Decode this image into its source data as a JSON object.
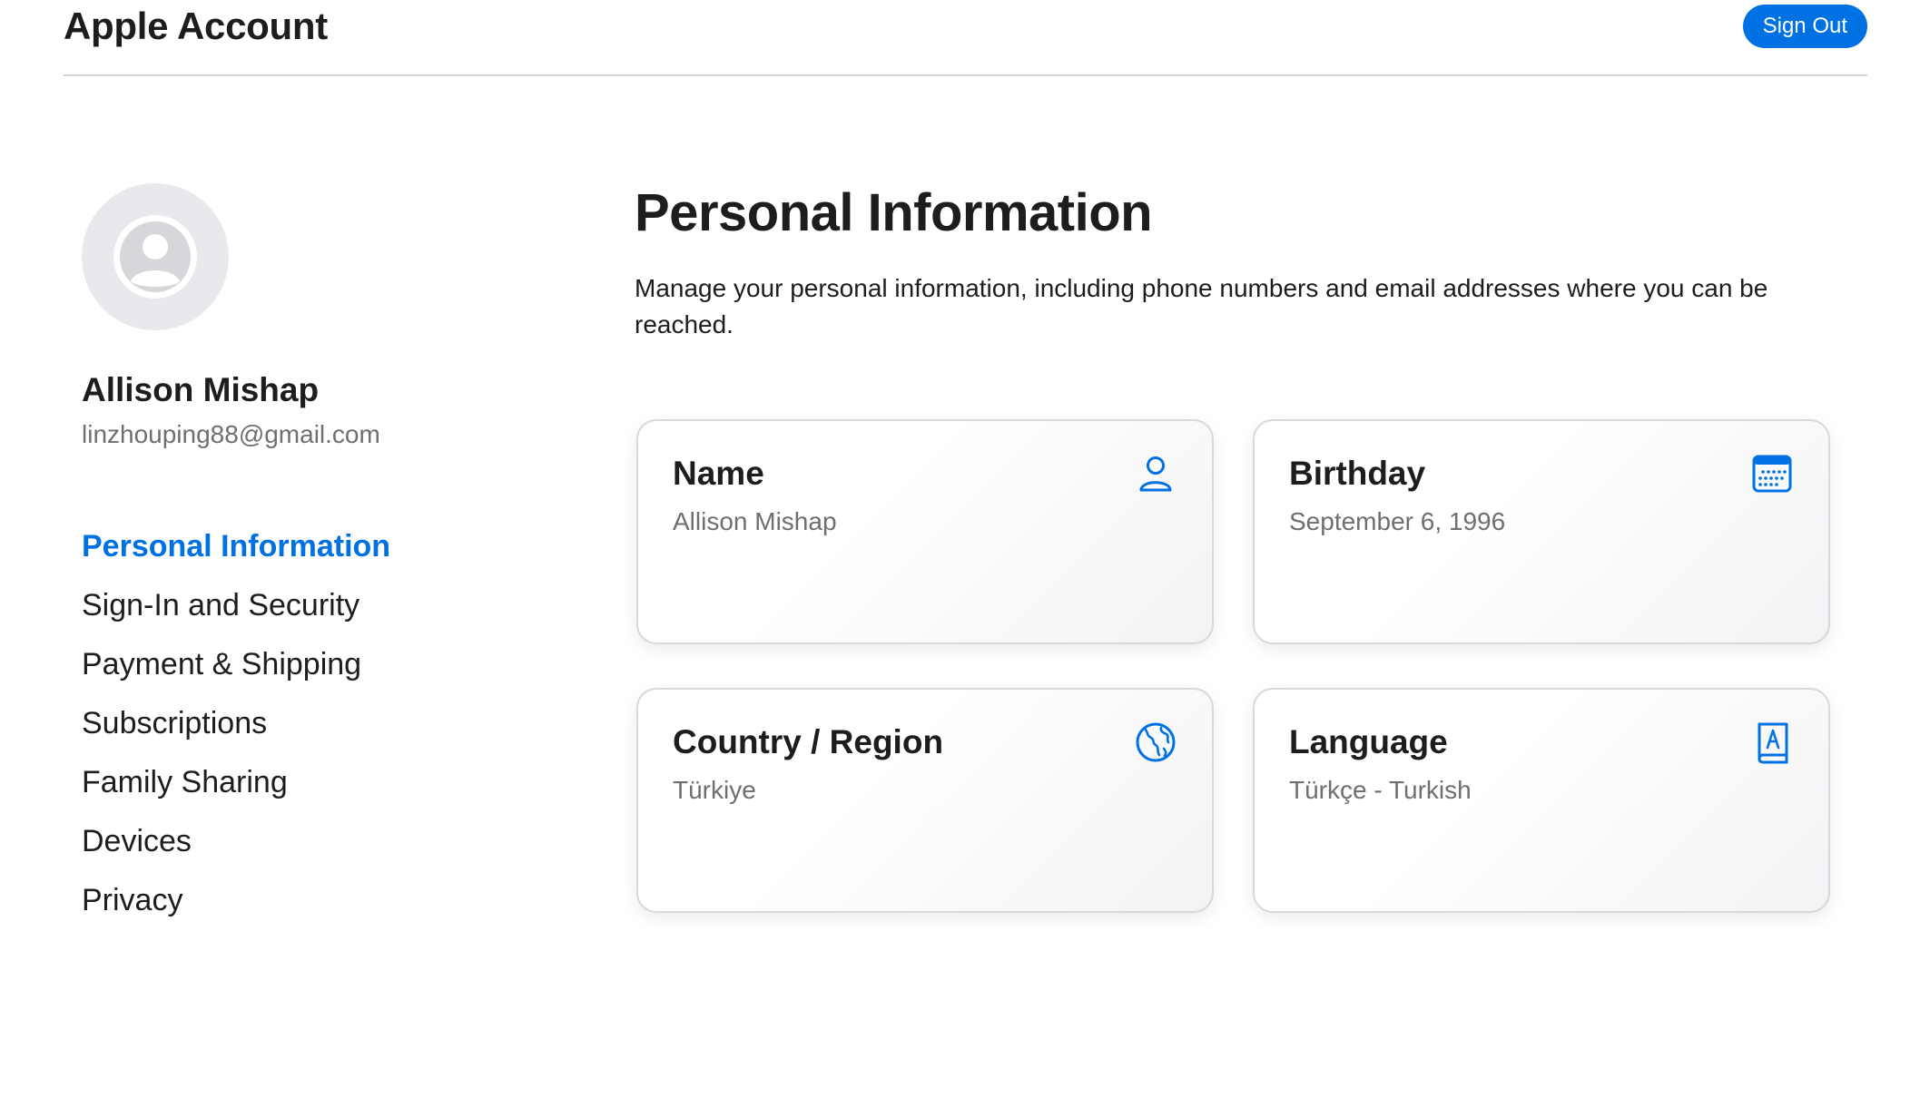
{
  "header": {
    "title": "Apple Account",
    "sign_out_label": "Sign Out"
  },
  "sidebar": {
    "user_name": "Allison Mishap",
    "user_email": "linzhouping88@gmail.com",
    "items": [
      {
        "label": "Personal Information",
        "active": true
      },
      {
        "label": "Sign-In and Security",
        "active": false
      },
      {
        "label": "Payment & Shipping",
        "active": false
      },
      {
        "label": "Subscriptions",
        "active": false
      },
      {
        "label": "Family Sharing",
        "active": false
      },
      {
        "label": "Devices",
        "active": false
      },
      {
        "label": "Privacy",
        "active": false
      }
    ]
  },
  "main": {
    "title": "Personal Information",
    "description": "Manage your personal information, including phone numbers and email addresses where you can be reached.",
    "cards": [
      {
        "title": "Name",
        "value": "Allison Mishap",
        "icon": "person-icon"
      },
      {
        "title": "Birthday",
        "value": "September 6, 1996",
        "icon": "calendar-icon"
      },
      {
        "title": "Country / Region",
        "value": "Türkiye",
        "icon": "globe-icon"
      },
      {
        "title": "Language",
        "value": "Türkçe - Turkish",
        "icon": "language-book-icon"
      }
    ]
  },
  "colors": {
    "accent": "#0071e3",
    "text_primary": "#1d1d1f",
    "text_secondary": "#6e6e73",
    "avatar_bg": "#e8e8ed",
    "divider": "#d2d2d7"
  }
}
